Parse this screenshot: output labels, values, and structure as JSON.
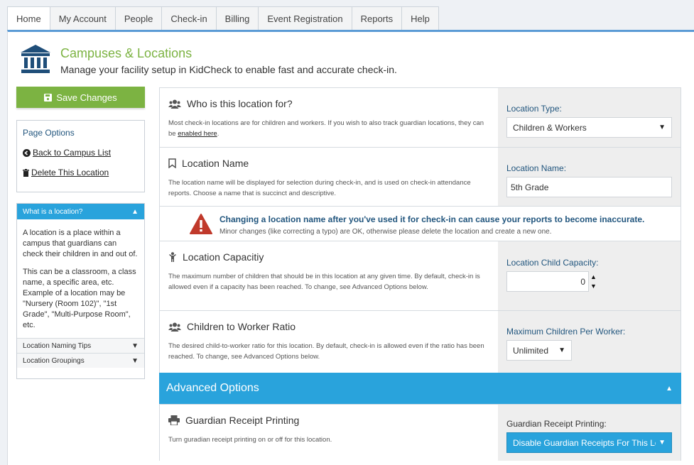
{
  "nav": {
    "tabs": [
      {
        "label": "Home",
        "active": true
      },
      {
        "label": "My Account"
      },
      {
        "label": "People"
      },
      {
        "label": "Check-in"
      },
      {
        "label": "Billing"
      },
      {
        "label": "Event Registration"
      },
      {
        "label": "Reports"
      },
      {
        "label": "Help"
      }
    ]
  },
  "header": {
    "title": "Campuses & Locations",
    "subtitle": "Manage your facility setup in KidCheck to enable fast and accurate check-in.",
    "icon": "building-columns-icon"
  },
  "sidebar": {
    "save_label": "Save Changes",
    "page_options_title": "Page Options",
    "back_label": "Back to Campus List",
    "delete_label": "Delete This Location",
    "help_head": "What is a location?",
    "help_p1": "A location is a place within a campus that guardians can check their children in and out of.",
    "help_p2": "This can be a classroom, a class name, a specific area, etc. Example of a location may be \"Nursery (Room 102)\", \"1st Grade\", \"Multi-Purpose Room\", etc.",
    "tips_label": "Location Naming Tips",
    "groupings_label": "Location Groupings"
  },
  "who": {
    "title": "Who is this location for?",
    "desc_before": "Most check-in locations are for children and workers. If you wish to also track guardian locations, they can be ",
    "desc_link": "enabled here",
    "desc_after": ".",
    "field_label": "Location Type:",
    "value": "Children & Workers"
  },
  "name": {
    "title": "Location Name",
    "desc": "The location name will be displayed for selection during check-in, and is used on check-in attendance reports. Choose a name that is succinct and descriptive.",
    "field_label": "Location Name:",
    "value": "5th Grade"
  },
  "warning": {
    "title": "Changing a location name after you've used it for check-in can cause your reports to become inaccurate.",
    "sub": "Minor changes (like correcting a typo) are OK, otherwise please delete the location and create a new one."
  },
  "capacity": {
    "title": "Location Capacitiy",
    "desc": "The maximum number of children that should be in this location at any given time. By default, check-in is allowed even if a capacity has been reached. To change, see Advanced Options below.",
    "field_label": "Location Child Capacity:",
    "value": "0"
  },
  "ratio": {
    "title": "Children to Worker Ratio",
    "desc": "The desired child-to-worker ratio for this location. By default, check-in is allowed even if the ratio has been reached. To change, see Advanced Options below.",
    "field_label": "Maximum Children Per Worker:",
    "value": "Unlimited"
  },
  "advanced": {
    "label": "Advanced Options"
  },
  "receipt": {
    "title": "Guardian Receipt Printing",
    "desc": "Turn guradian receipt printing on or off for this location.",
    "field_label": "Guardian Receipt Printing:",
    "value": "Disable Guardian Receipts For This Lo"
  },
  "colors": {
    "accent_green": "#7cb342",
    "accent_blue": "#29a3dc",
    "label_blue": "#22567e",
    "warning_red": "#c0392b"
  }
}
